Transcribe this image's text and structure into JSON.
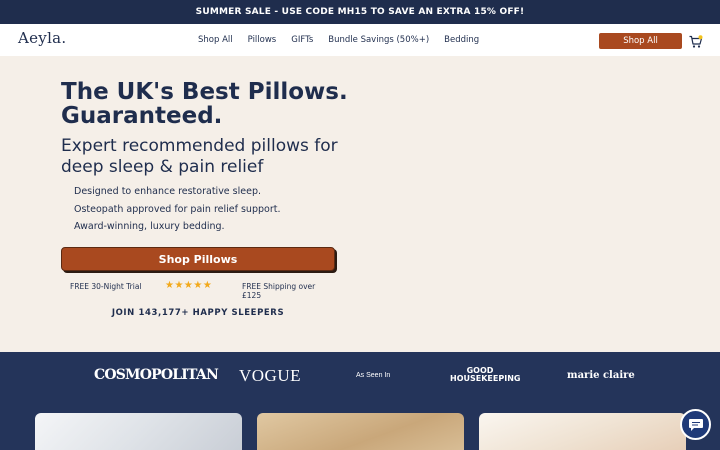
{
  "announcement": {
    "text": "SUMMER SALE - USE CODE MH15 TO SAVE AN EXTRA 15% OFF!"
  },
  "header": {
    "logo": "Aeyla.",
    "menu": [
      "Shop All",
      "Pillows",
      "GIFTs",
      "Bundle Savings (50%+)",
      "Bedding"
    ],
    "shop_all_label": "Shop All",
    "cart_icon": "cart-icon"
  },
  "hero": {
    "title_line1": "The UK's Best Pillows.",
    "title_line2": "Guaranteed.",
    "subtitle_line1": "Expert recommended pillows for",
    "subtitle_line2": "deep sleep & pain relief",
    "bullets": [
      "Designed to enhance restorative sleep.",
      "Osteopath approved for pain relief support.",
      "Award-winning, luxury bedding."
    ],
    "cta_label": "Shop Pillows",
    "trial_text": "FREE 30-Night Trial",
    "rating_stars": 5,
    "shipping_text": "FREE Shipping over £125",
    "join_text": "JOIN 143,177+ HAPPY SLEEPERS"
  },
  "press": {
    "logos": [
      "COSMOPOLITAN",
      "VOGUE",
      "As Seen In",
      "GOOD HOUSEKEEPING",
      "marie claire"
    ],
    "gh_line1": "GOOD",
    "gh_line2": "HOUSEKEEPING"
  },
  "colors": {
    "navy": "#1f2d4d",
    "rust": "#a9491f",
    "cream": "#f5efe8",
    "star": "#f2a91b"
  },
  "chat": {
    "icon": "chat-icon"
  }
}
